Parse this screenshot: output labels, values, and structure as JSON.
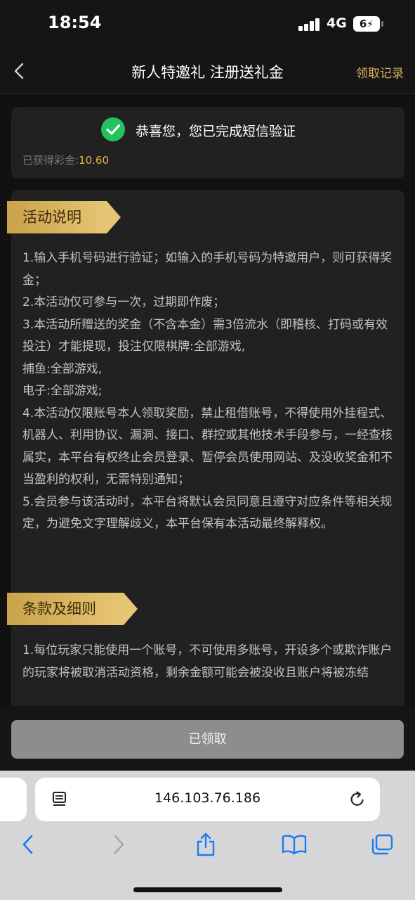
{
  "status_bar": {
    "time": "18:54",
    "network": "4G",
    "battery": "6"
  },
  "nav": {
    "title": "新人特邀礼 注册送礼金",
    "record_link": "领取记录",
    "back_icon": "chevron-left-icon"
  },
  "verify": {
    "message": "恭喜您，您已完成短信验证",
    "bonus_label": "已获得彩金:",
    "bonus_value": "10.60",
    "icon": "check-circle-icon"
  },
  "sections": [
    {
      "title": "活动说明",
      "lines": [
        "1.输入手机号码进行验证；如输入的手机号码为特邀用户，则可获得奖金；",
        "2.本活动仅可参与一次，过期即作废；",
        "3.本活动所赠送的奖金（不含本金）需3倍流水（即稽核、打码或有效投注）才能提现，投注仅限棋牌:全部游戏,",
        "捕鱼:全部游戏,",
        "电子:全部游戏;",
        "4.本活动仅限账号本人领取奖励，禁止租借账号，不得使用外挂程式、机器人、利用协议、漏洞、接口、群控或其他技术手段参与，一经查核属实，本平台有权终止会员登录、暂停会员使用网站、及没收奖金和不当盈利的权利，无需特别通知；",
        "5.会员参与该活动时，本平台将默认会员同意且遵守对应条件等相关规定，为避免文字理解歧义，本平台保有本活动最终解释权。"
      ]
    },
    {
      "title": "条款及细则",
      "lines": [
        "1.每位玩家只能使用一个账号，不可使用多账号，开设多个或欺诈账户的玩家将被取消活动资格，剩余金额可能会被没收且账户将被冻结"
      ]
    }
  ],
  "claim_button": "已领取",
  "browser": {
    "url": "146.103.76.186"
  },
  "colors": {
    "accent_gold": "#d8b25a",
    "bonus_gold": "#e2b24a",
    "success_green": "#22c35e",
    "disabled_button": "#8d8d8d",
    "browser_blue": "#1a7cf0"
  }
}
